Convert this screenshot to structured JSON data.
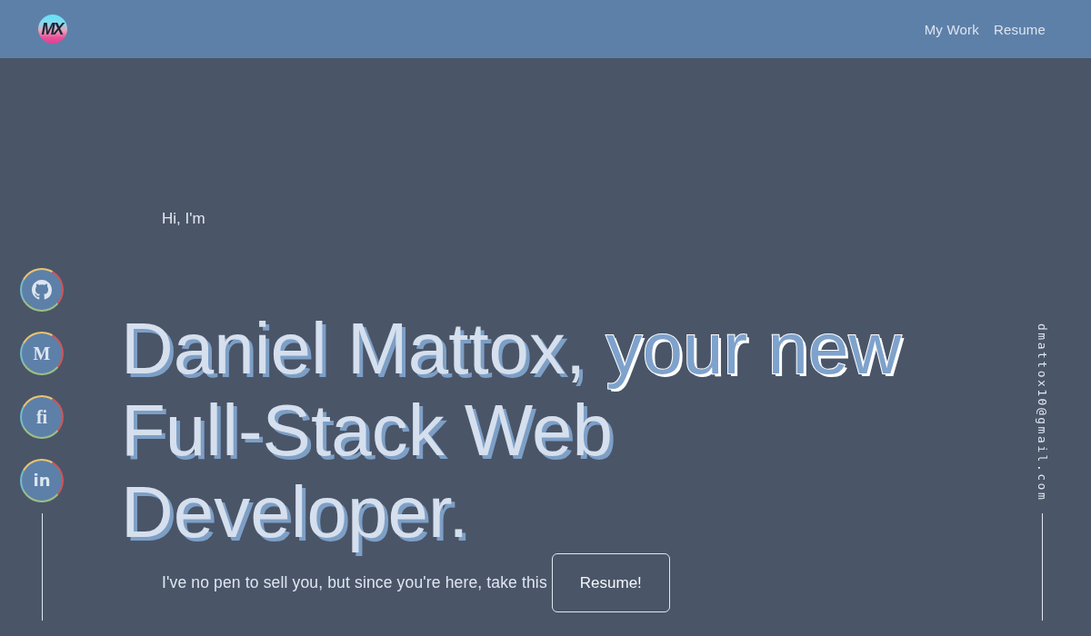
{
  "header": {
    "logo": {
      "text": "MX"
    },
    "nav": [
      {
        "label": "My Work"
      },
      {
        "label": "Resume"
      }
    ]
  },
  "social_links": [
    {
      "kind": "octocat"
    },
    {
      "kind": "serif",
      "text": "M"
    },
    {
      "kind": "serif",
      "text": "fi"
    },
    {
      "kind": "sans",
      "text": "in"
    }
  ],
  "hero": {
    "greeting": "Hi, I'm",
    "headline": [
      {
        "text": "Daniel Mattox,",
        "kind": "filled"
      },
      {
        "text": "your new",
        "kind": "outlined"
      },
      {
        "text": "Full-Stack Web Developer.",
        "kind": "filled"
      }
    ],
    "tagline": "I've no pen to sell you, but since you're here, take this",
    "button": "Resume!"
  },
  "email": "dmattox10@gmail.com"
}
